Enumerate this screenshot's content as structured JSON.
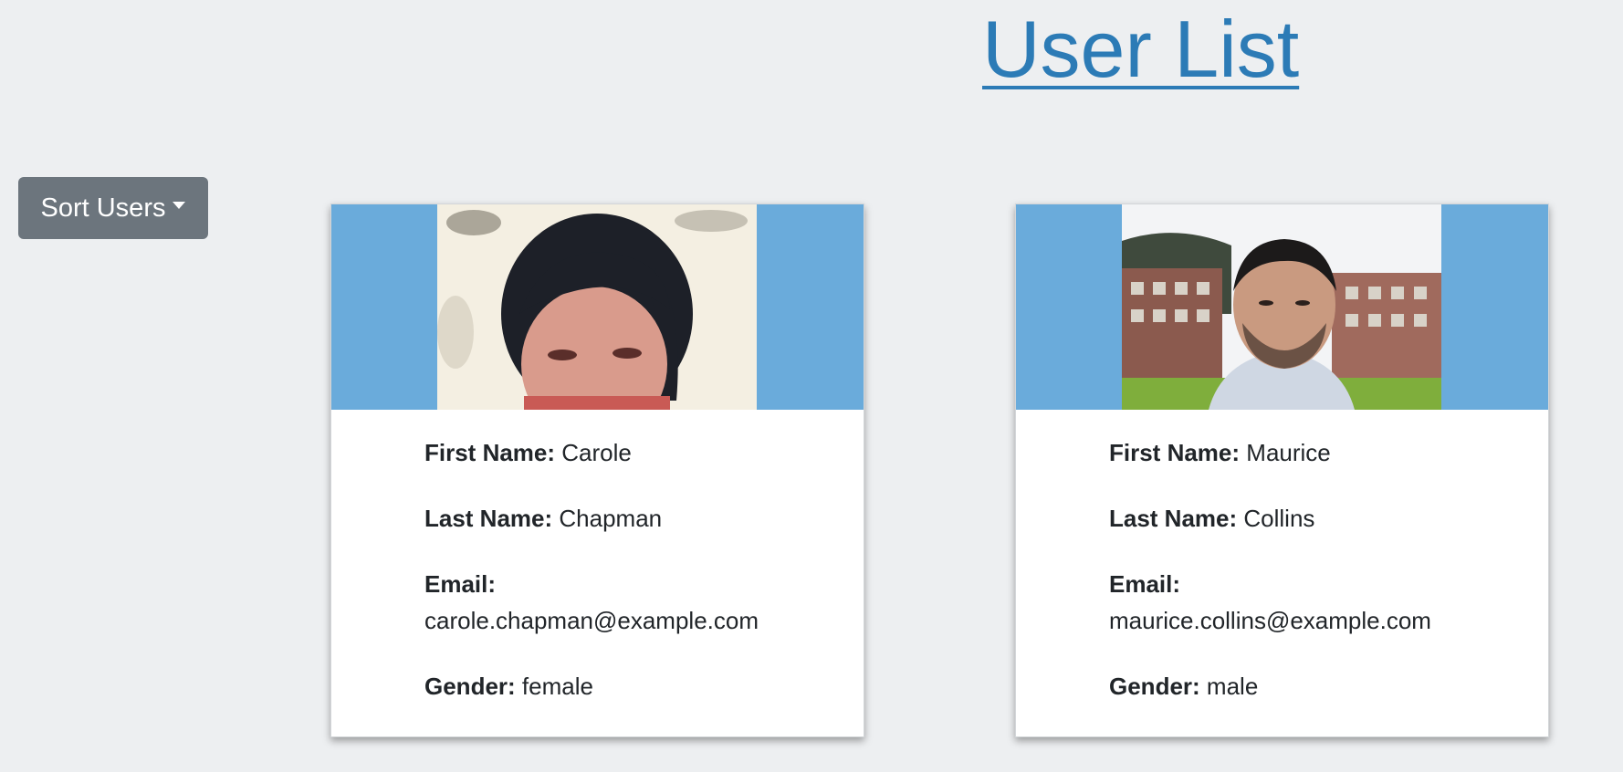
{
  "header": {
    "title": "User List"
  },
  "toolbar": {
    "sort_label": "Sort Users",
    "sort_icon": "caret-down-icon"
  },
  "colors": {
    "background": "#edeff1",
    "title_link": "#2c7bb6",
    "sort_button": "#6c757d",
    "photo_band": "#6aabdb",
    "card": "#ffffff"
  },
  "labels": {
    "first_name": "First Name:",
    "last_name": "Last Name:",
    "email": "Email:",
    "gender": "Gender:"
  },
  "users": [
    {
      "first_name": "Carole",
      "last_name": "Chapman",
      "email": "carole.chapman@example.com",
      "gender": "female"
    },
    {
      "first_name": "Maurice",
      "last_name": "Collins",
      "email": "maurice.collins@example.com",
      "gender": "male"
    }
  ]
}
